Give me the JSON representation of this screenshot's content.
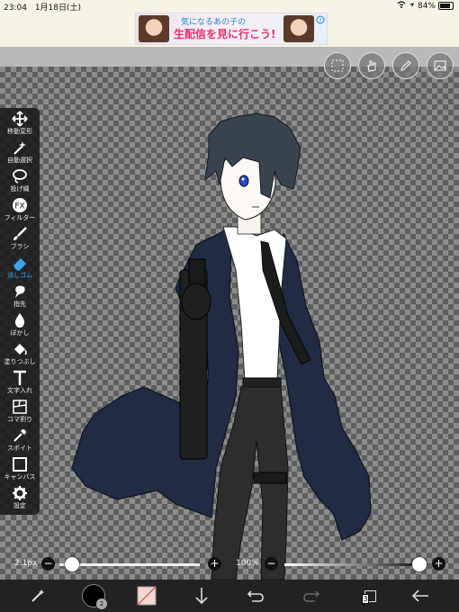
{
  "status_bar": {
    "time": "23:04",
    "date": "1月18日(土)",
    "battery": "84%",
    "battery_level": 0.84
  },
  "ad": {
    "line1": "気になるあの子の",
    "line2": "生配信を見に行こう!"
  },
  "toolbar": {
    "tools": [
      {
        "id": "move",
        "label": "移動変形",
        "icon": "move-icon"
      },
      {
        "id": "auto-select",
        "label": "自動選択",
        "icon": "magic-wand-icon"
      },
      {
        "id": "lasso",
        "label": "投げ縄",
        "icon": "lasso-icon"
      },
      {
        "id": "filter",
        "label": "フィルター",
        "icon": "fx-icon"
      },
      {
        "id": "brush",
        "label": "ブラシ",
        "icon": "brush-icon"
      },
      {
        "id": "eraser",
        "label": "消しゴム",
        "icon": "eraser-icon"
      },
      {
        "id": "finger",
        "label": "指先",
        "icon": "finger-icon"
      },
      {
        "id": "blur",
        "label": "ぼかし",
        "icon": "droplet-icon"
      },
      {
        "id": "fill",
        "label": "塗りつぶし",
        "icon": "bucket-icon"
      },
      {
        "id": "text",
        "label": "文字入れ",
        "icon": "text-icon"
      },
      {
        "id": "frame",
        "label": "コマ割り",
        "icon": "panel-icon"
      },
      {
        "id": "eyedropper",
        "label": "スポイト",
        "icon": "eyedropper-icon"
      },
      {
        "id": "canvas",
        "label": "キャンバス",
        "icon": "canvas-icon"
      },
      {
        "id": "settings",
        "label": "設定",
        "icon": "gear-icon"
      }
    ],
    "active_tool": "eraser"
  },
  "top_tools": [
    "selection-icon",
    "hand-icon",
    "pen-icon",
    "gallery-icon"
  ],
  "brush_slider": {
    "value": "2.1px",
    "level": 0.0
  },
  "opacity_slider": {
    "value": "100%",
    "level": 1.0
  },
  "bottom": {
    "brush_size": "2",
    "layer_count": "3",
    "icons": [
      "magic-brush-icon",
      "color-icon",
      "secondary-color-icon",
      "download-icon",
      "undo-icon",
      "redo-icon",
      "layers-icon",
      "back-icon"
    ]
  },
  "colors": {
    "accent": "#39a7ef",
    "coat": "#222b44",
    "hair": "#3a4450",
    "eye": "#2a4bd0"
  }
}
